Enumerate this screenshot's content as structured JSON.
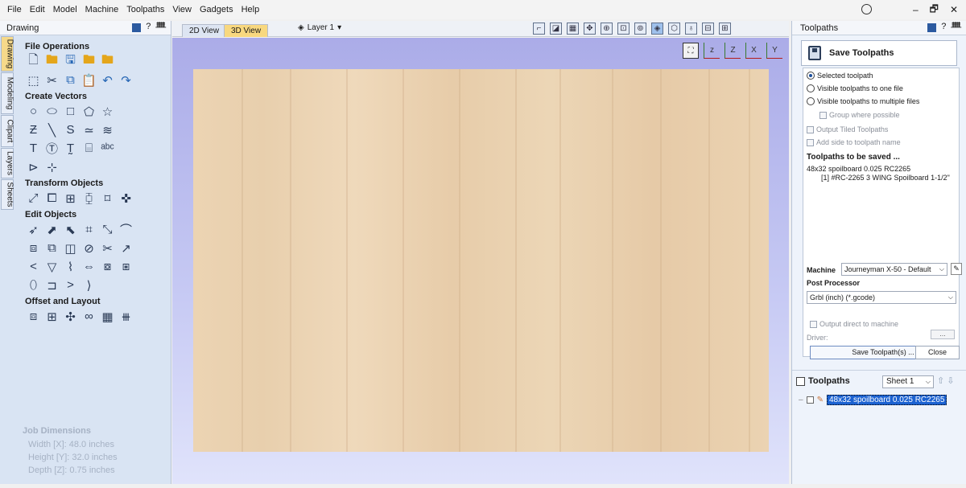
{
  "menu": [
    "File",
    "Edit",
    "Model",
    "Machine",
    "Toolpaths",
    "View",
    "Gadgets",
    "Help"
  ],
  "window_controls": [
    "–",
    "🗗",
    "✕"
  ],
  "left_panel": {
    "title": "Drawing",
    "header_controls": [
      "?",
      "ᚙ"
    ],
    "vertical_tabs": [
      "Drawing",
      "Modeling",
      "Clipart",
      "Layers",
      "Sheets"
    ],
    "sections": [
      {
        "title": "File Operations",
        "rows": [
          [
            "new-file-icon",
            "open-folder-icon",
            "save-icon",
            "import-folder-icon",
            "export-folder-icon"
          ],
          [
            "select-all-icon",
            "cut-icon",
            "copy-icon",
            "paste-icon",
            "undo-icon",
            "redo-icon"
          ]
        ]
      },
      {
        "title": "Create Vectors",
        "rows": [
          [
            "circle-icon",
            "ellipse-icon",
            "rectangle-icon",
            "polygon-icon",
            "star-icon"
          ],
          [
            "polyline-icon",
            "arc-icon",
            "curve-icon",
            "spiral-icon",
            "pattern-icon"
          ],
          [
            "text-icon",
            "text-frame-icon",
            "text-on-curve-icon",
            "autolayout-text-icon",
            "bitmap-text-icon"
          ],
          [
            "dimension-icon",
            "measure-icon"
          ]
        ]
      },
      {
        "title": "Transform Objects",
        "rows": [
          [
            "move-icon",
            "scale-icon",
            "align-icon",
            "mirror-icon",
            "distort-icon",
            "center-icon"
          ]
        ]
      },
      {
        "title": "Edit Objects",
        "rows": [
          [
            "select-icon",
            "node-edit-icon",
            "interactive-transform-icon",
            "trim-icon",
            "join-icon",
            "smooth-icon"
          ],
          [
            "weld-icon",
            "subtract-icon",
            "intersect-icon",
            "fillet-icon",
            "scissors-icon",
            "extend-icon"
          ],
          [
            "chevron-icon",
            "v-shape-icon",
            "curve-fit-icon",
            "convert-icon",
            "offset-icon",
            "nest-icon"
          ],
          [
            "closed-icon",
            "open-right-icon",
            "arrow-right-icon",
            "bracket-icon"
          ]
        ]
      },
      {
        "title": "Offset and Layout",
        "rows": [
          [
            "offset-icon",
            "array-icon",
            "nesting-icon",
            "copy-along-icon",
            "grid-copy-icon",
            "tile-icon"
          ]
        ]
      }
    ],
    "job_dimensions": {
      "title": "Job Dimensions",
      "width": "Width  [X]: 48.0 inches",
      "height": "Height [Y]: 32.0 inches",
      "depth": "Depth  [Z]: 0.75 inches"
    }
  },
  "center": {
    "tabs": [
      "2D View",
      "3D View"
    ],
    "active_tab": "3D View",
    "layer_label": "Layer 1",
    "view_tools": [
      "draw-icon",
      "model-icon",
      "grid-icon",
      "pan-icon",
      "zoom-in-icon",
      "zoom-box-icon",
      "zoom-extents-icon",
      "shaded-icon",
      "wireframe-icon",
      "render-icon",
      "split-view-icon",
      "window-icon"
    ],
    "axes": [
      "fit-icon",
      "axis-y-up-icon",
      "axis-z-icon",
      "axis-x-icon",
      "axis-z-front-icon",
      "axis-y-icon"
    ]
  },
  "right_panel": {
    "title": "Toolpaths",
    "header_controls": [
      "?",
      "ᚙ"
    ],
    "save_title": "Save Toolpaths",
    "options": [
      {
        "label": "Selected toolpath",
        "type": "radio",
        "checked": true
      },
      {
        "label": "Visible toolpaths to one file",
        "type": "radio",
        "checked": false
      },
      {
        "label": "Visible toolpaths to multiple files",
        "type": "radio",
        "checked": false
      },
      {
        "label": "Group where possible",
        "type": "checkbox",
        "disabled": true
      },
      {
        "label": "Output Tiled Toolpaths",
        "type": "checkbox",
        "disabled": true
      },
      {
        "label": "Add side to toolpath name",
        "type": "checkbox",
        "disabled": true
      }
    ],
    "to_be_saved_title": "Toolpaths to be saved ...",
    "to_be_saved": [
      "48x32 spoilboard 0.025 RC2265",
      "[1] #RC-2265 3 WING Spoilboard 1-1/2\""
    ],
    "machine_label": "Machine",
    "machine_value": "Journeyman X-50 - Default",
    "post_label": "Post Processor",
    "post_value": "Grbl (inch) (*.gcode)",
    "output_direct": "Output direct to machine",
    "driver_label": "Driver:",
    "driver_btn": "...",
    "save_button": "Save Toolpath(s) ...",
    "close_button": "Close",
    "toolpaths_section": {
      "title": "Toolpaths",
      "sheet": "Sheet 1",
      "item": "48x32 spoilboard 0.025 RC2265"
    }
  }
}
